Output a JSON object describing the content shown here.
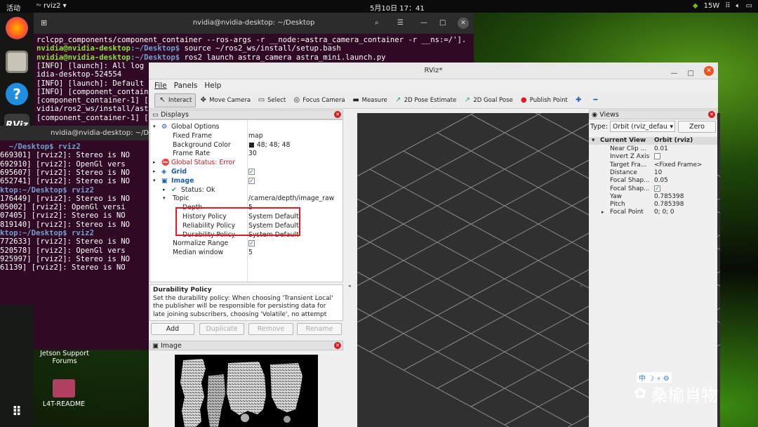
{
  "topbar": {
    "activities": "活动",
    "app": "rviz2",
    "clock": "5月10日  17：41",
    "power": "15W"
  },
  "desktop": {
    "jetson_label": "Jetson Support Forums",
    "readme_label": "L4T-README"
  },
  "watermark": {
    "text": "桑榆肖物",
    "ime": "中 ☽ ∘ ⚙"
  },
  "terminal_back": {
    "title": "nvidia@nvidia-desktop: ~/Desktop",
    "lines": [
      "rclcpp_components/component_container --ros-args -r __node:=astra_camera_container -r __ns:=/'].",
      "nvidia@nvidia-desktop:~/Desktop$ source ~/ros2_ws/install/setup.bash",
      "nvidia@nvidia-desktop:~/Desktop$ ros2 launch astra_camera astra_mini.launch.py",
      "[INFO] [launch]: All log fi",
      "idia-desktop-524554",
      "[INFO] [launch]: Default l",
      "[INFO] [component_containe",
      "[component_container-1] [I",
      "vidia/ros2_ws/install/astr",
      "[component_container-1] [I"
    ]
  },
  "terminal_front": {
    "title": "nvidia@nvidia-desktop: ~/Desktop",
    "lines": [
      "  ~/Desktop$ rviz2",
      "669301] [rviz2]: Stereo is NO",
      "692910] [rviz2]: OpenGl vers",
      "695607] [rviz2]: Stereo is NO",
      "652741] [rviz2]: Stereo is NO",
      "ktop:~/Desktop$ rviz2",
      "176449] [rviz2]: Stereo is NO",
      "05002] [rviz2]: OpenGl versi",
      "07405] [rviz2]: Stereo is NO",
      "819140] [rviz2]: Stereo is NO",
      "ktop:~/Desktop$ rviz2",
      "772633] [rviz2]: Stereo is NO",
      "520578] [rviz2]: OpenGl vers",
      "925997] [rviz2]: Stereo is NO",
      "61139] [rviz2]: Stereo is NO"
    ]
  },
  "rviz": {
    "title": "RViz*",
    "menu": [
      "File",
      "Panels",
      "Help"
    ],
    "toolbar": [
      {
        "label": "Interact",
        "icon": "↖"
      },
      {
        "label": "Move Camera",
        "icon": "✥"
      },
      {
        "label": "Select",
        "icon": "▭"
      },
      {
        "label": "Focus Camera",
        "icon": "◎"
      },
      {
        "label": "Measure",
        "icon": "▬"
      },
      {
        "label": "2D Pose Estimate",
        "icon": "↗"
      },
      {
        "label": "2D Goal Pose",
        "icon": "↗"
      },
      {
        "label": "Publish Point",
        "icon": "●"
      },
      {
        "label": "",
        "icon": "✚"
      },
      {
        "label": "",
        "icon": "━"
      }
    ],
    "displays": {
      "title": "Displays",
      "rows": [
        {
          "name": "Global Options",
          "value": "",
          "indent": 1,
          "arrow": "▾",
          "icon": "⚙"
        },
        {
          "name": "Fixed Frame",
          "value": "map",
          "indent": 2
        },
        {
          "name": "Background Color",
          "value": "■ 48; 48; 48",
          "indent": 2
        },
        {
          "name": "Frame Rate",
          "value": "30",
          "indent": 2
        },
        {
          "name": "Global Status: Error",
          "value": "",
          "indent": 1,
          "arrow": "▸",
          "icon": "⛔",
          "color": "#c01c28"
        },
        {
          "name": "Grid",
          "value": "✓",
          "indent": 1,
          "arrow": "▸",
          "icon": "◈",
          "color": "#1a5fb4",
          "bold": true,
          "check": true
        },
        {
          "name": "Image",
          "value": "✓",
          "indent": 1,
          "arrow": "▾",
          "icon": "▣",
          "color": "#1a5fb4",
          "bold": true,
          "check": true
        },
        {
          "name": "Status: Ok",
          "value": "",
          "indent": 2,
          "arrow": "▸",
          "icon": "✔"
        },
        {
          "name": "Topic",
          "value": "/camera/depth/image_raw",
          "indent": 2,
          "arrow": "▾"
        },
        {
          "name": "Depth",
          "value": "5",
          "indent": 3
        },
        {
          "name": "History Policy",
          "value": "System Default",
          "indent": 3
        },
        {
          "name": "Reliability Policy",
          "value": "System Default",
          "indent": 3
        },
        {
          "name": "Durability Policy",
          "value": "System Default",
          "indent": 3
        },
        {
          "name": "Normalize Range",
          "value": "✓",
          "indent": 2,
          "check": true
        },
        {
          "name": "Median window",
          "value": "5",
          "indent": 2
        }
      ]
    },
    "help": {
      "title": "Durability Policy",
      "text": "Set the durability policy: When choosing 'Transient Local' the publisher will be responsible for persisting data for late joining subscribers, choosing 'Volatile', no attempt"
    },
    "buttons": {
      "add": "Add",
      "duplicate": "Duplicate",
      "remove": "Remove",
      "rename": "Rename"
    },
    "image_panel": {
      "title": "Image"
    },
    "views": {
      "title": "Views",
      "type_label": "Type:",
      "type_value": "Orbit (rviz_defau",
      "zero": "Zero",
      "header_name": "Current View",
      "header_value": "Orbit (rviz)",
      "rows": [
        {
          "name": "Near Clip ...",
          "value": "0.01"
        },
        {
          "name": "Invert Z Axis",
          "value": "☐",
          "check": true
        },
        {
          "name": "Target Fra...",
          "value": "<Fixed Frame>"
        },
        {
          "name": "Distance",
          "value": "10"
        },
        {
          "name": "Focal Shap...",
          "value": "0.05"
        },
        {
          "name": "Focal Shap...",
          "value": "✓",
          "check": true
        },
        {
          "name": "Yaw",
          "value": "0.785398"
        },
        {
          "name": "Pitch",
          "value": "0.785398"
        },
        {
          "name": "Focal Point",
          "value": "0; 0; 0",
          "arrow": "▸"
        }
      ]
    }
  }
}
